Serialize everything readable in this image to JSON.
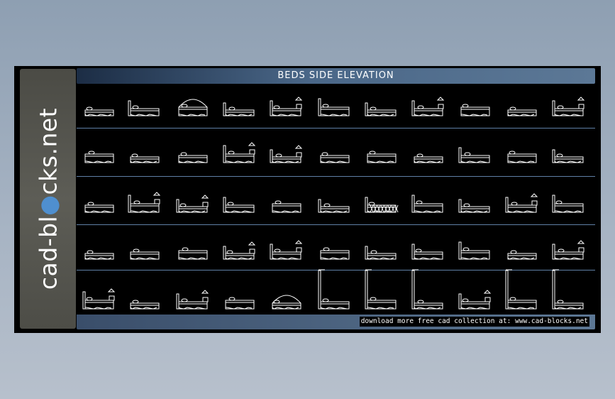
{
  "logo": {
    "text_before": "cad-bl",
    "text_dot": "●",
    "text_after": "cks.net",
    "dot_color": "#4f8fcf"
  },
  "title": "BEDS SIDE ELEVATION",
  "footer": "download more free cad collection at: www.cad-blocks.net",
  "colors": {
    "sheet": "#000000",
    "line_art": "#ffffff",
    "row_separator": "#5f7fa6",
    "title_bar": "#4a6788"
  },
  "rows": [
    {
      "beds": [
        "plain",
        "headboard",
        "canopy",
        "headboard",
        "lamp",
        "headboard",
        "headboard",
        "lamp",
        "plain",
        "plain",
        "lamp"
      ]
    },
    {
      "beds": [
        "plain",
        "plain",
        "plain",
        "lamp",
        "lamp",
        "plain",
        "plain",
        "plain",
        "headboard",
        "plain",
        "headboard"
      ]
    },
    {
      "beds": [
        "plain",
        "lamp",
        "lamp",
        "headboard",
        "plain",
        "headboard",
        "lattice",
        "headboard",
        "headboard",
        "lamp",
        "headboard"
      ]
    },
    {
      "beds": [
        "plain",
        "plain",
        "plain",
        "lamp",
        "lamp",
        "plain",
        "headboard",
        "headboard",
        "headboard",
        "plain",
        "lamp"
      ]
    },
    {
      "beds": [
        "lamp",
        "plain",
        "lamp",
        "plain",
        "canopy",
        "tall",
        "tall",
        "tall",
        "lamp",
        "tall",
        "tall"
      ]
    }
  ]
}
